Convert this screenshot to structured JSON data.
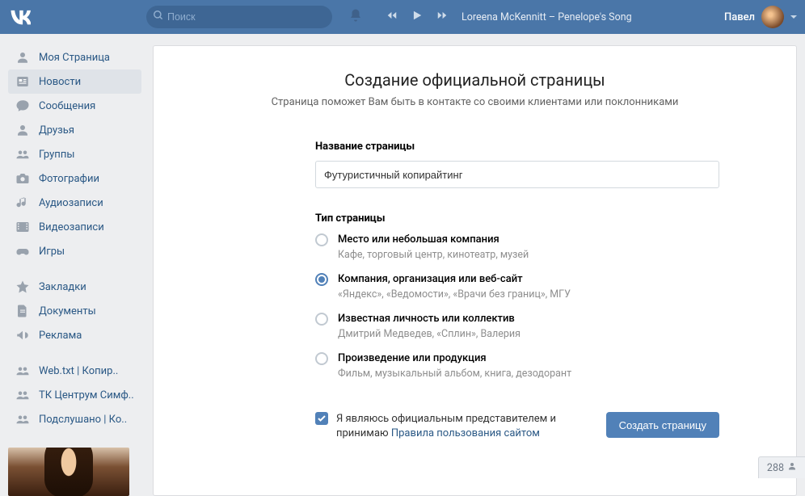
{
  "topbar": {
    "search_placeholder": "Поиск",
    "now_playing": "Loreena McKennitt – Penelope's Song",
    "username": "Павел"
  },
  "sidebar": {
    "items": [
      {
        "icon": "user",
        "label": "Моя Страница"
      },
      {
        "icon": "news",
        "label": "Новости",
        "active": true
      },
      {
        "icon": "messages",
        "label": "Сообщения"
      },
      {
        "icon": "friends",
        "label": "Друзья"
      },
      {
        "icon": "groups",
        "label": "Группы"
      },
      {
        "icon": "photos",
        "label": "Фотографии"
      },
      {
        "icon": "audio",
        "label": "Аудиозаписи"
      },
      {
        "icon": "video",
        "label": "Видеозаписи"
      },
      {
        "icon": "games",
        "label": "Игры"
      }
    ],
    "items2": [
      {
        "icon": "star",
        "label": "Закладки"
      },
      {
        "icon": "docs",
        "label": "Документы"
      },
      {
        "icon": "ads",
        "label": "Реклама"
      }
    ],
    "items3": [
      {
        "icon": "groups",
        "label": "Web.txt | Копир.."
      },
      {
        "icon": "groups",
        "label": "ТК Центрум Симф.."
      },
      {
        "icon": "groups",
        "label": "Подслушано | Ко.."
      }
    ]
  },
  "content": {
    "title": "Создание официальной страницы",
    "subtitle": "Страница поможет Вам быть в контакте со своими клиентами или поклонниками",
    "name_label": "Название страницы",
    "name_value": "Футуристичный копирайтинг",
    "type_label": "Тип страницы",
    "types": [
      {
        "label": "Место или небольшая компания",
        "desc": "Кафе, торговый центр, кинотеатр, музей",
        "selected": false
      },
      {
        "label": "Компания, организация или веб-сайт",
        "desc": "«Яндекс», «Ведомости», «Врачи без границ», МГУ",
        "selected": true
      },
      {
        "label": "Известная личность или коллектив",
        "desc": "Дмитрий Медведев, «Сплин», Валерия",
        "selected": false
      },
      {
        "label": "Произведение или продукция",
        "desc": "Фильм, музыкальный альбом, книга, дезодорант",
        "selected": false
      }
    ],
    "terms_text_1": "Я являюсь официальным представителем и принимаю ",
    "terms_link": "Правила пользования сайтом",
    "submit": "Создать страницу"
  },
  "counter": "288"
}
